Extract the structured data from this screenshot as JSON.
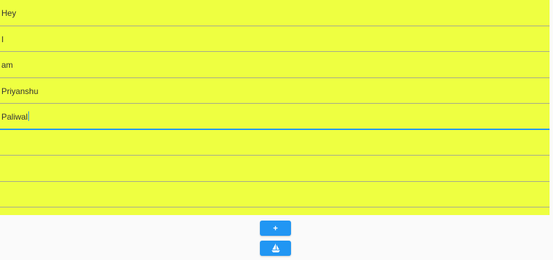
{
  "colors": {
    "pad_background": "#eeff41",
    "line_divider": "#a3a890",
    "focus_underline": "#2196f3",
    "button_background": "#2196f3",
    "page_background": "#fafafa"
  },
  "note_lines": [
    {
      "text": "Hey"
    },
    {
      "text": "I"
    },
    {
      "text": "am"
    },
    {
      "text": "Priyanshu"
    },
    {
      "text": "Paliwal"
    },
    {
      "text": ""
    },
    {
      "text": ""
    },
    {
      "text": ""
    }
  ],
  "focused_line": 4,
  "buttons": {
    "add_label": "+",
    "sail_icon": "sailboat-icon"
  }
}
